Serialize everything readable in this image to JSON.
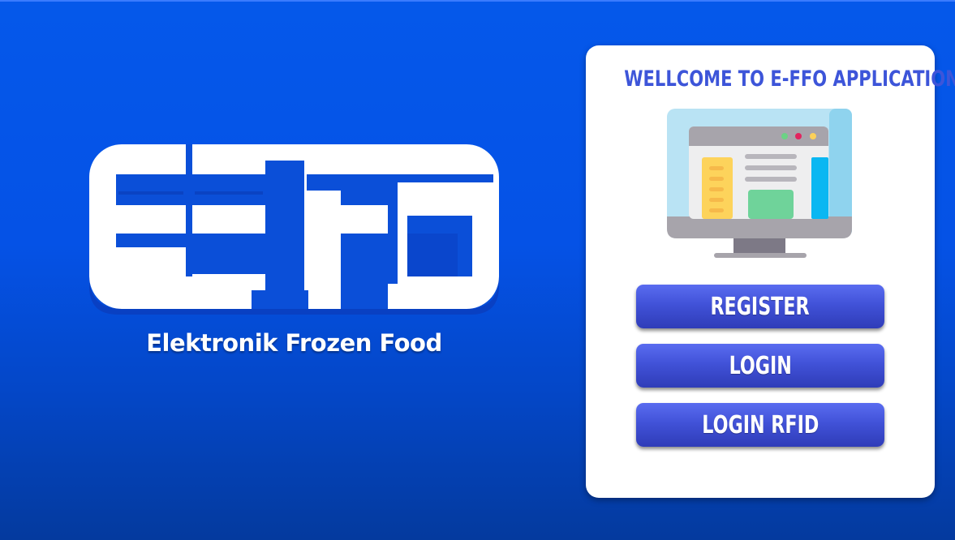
{
  "logo": {
    "wordmark": "EEFO",
    "tagline": "Elektronik Frozen Food"
  },
  "card": {
    "title": "WELLCOME TO E-FFO APPLICATION",
    "illustration": "desktop-monitor-icon",
    "buttons": {
      "register": "REGISTER",
      "login": "LOGIN",
      "login_rfid": "LOGIN RFID"
    }
  },
  "colors": {
    "background": "#0552e6",
    "card": "#ffffff",
    "title": "#3d55d9",
    "button": "#4152d8"
  }
}
